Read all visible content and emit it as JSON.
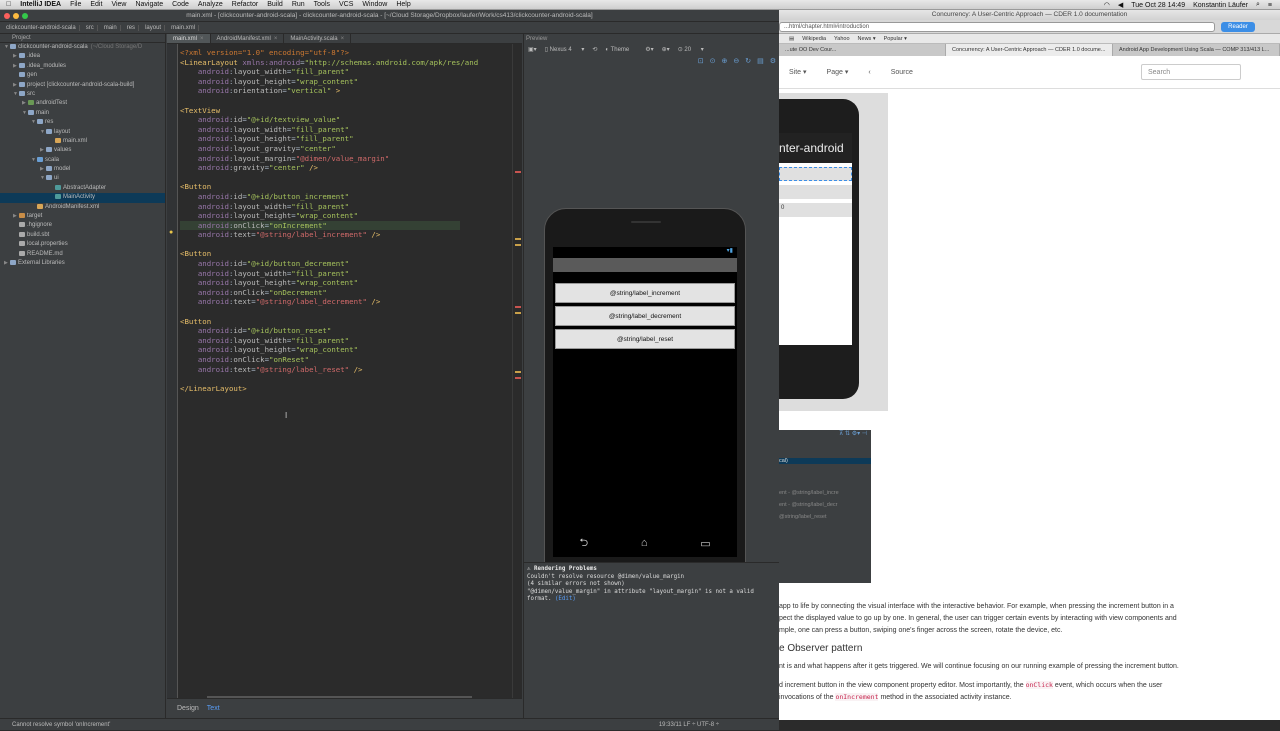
{
  "menubar": {
    "app": "IntelliJ IDEA",
    "items": [
      "File",
      "Edit",
      "View",
      "Navigate",
      "Code",
      "Analyze",
      "Refactor",
      "Build",
      "Run",
      "Tools",
      "VCS",
      "Window",
      "Help"
    ],
    "clock": "Tue Oct 28  14:49",
    "user": "Konstantin Läufer"
  },
  "ide": {
    "title": "main.xml - [clickcounter-android-scala] - clickcounter-android-scala - [~/Cloud Storage/Dropbox/laufer/Work/cs413/clickcounter-android-scala]",
    "breadcrumbs": [
      "clickcounter-android-scala",
      "src",
      "main",
      "res",
      "layout",
      "main.xml"
    ],
    "project_label": "Project",
    "tree": [
      {
        "label": "clickcounter-android-scala",
        "sub": "(~/Cloud Storage/D",
        "depth": 0,
        "arrow": "▼",
        "color": "#8ea7c7"
      },
      {
        "label": ".idea",
        "depth": 1,
        "arrow": "▶",
        "color": "#8ea7c7"
      },
      {
        "label": ".idea_modules",
        "depth": 1,
        "arrow": "▶",
        "color": "#8ea7c7"
      },
      {
        "label": "gen",
        "depth": 1,
        "arrow": "",
        "color": "#8ea7c7"
      },
      {
        "label": "project [clickcounter-android-scala-build]",
        "depth": 1,
        "arrow": "▶",
        "color": "#8ea7c7"
      },
      {
        "label": "src",
        "depth": 1,
        "arrow": "▼",
        "color": "#8ea7c7"
      },
      {
        "label": "androidTest",
        "depth": 2,
        "arrow": "▶",
        "color": "#6a9955"
      },
      {
        "label": "main",
        "depth": 2,
        "arrow": "▼",
        "color": "#8ea7c7"
      },
      {
        "label": "res",
        "depth": 3,
        "arrow": "▼",
        "color": "#8ea7c7"
      },
      {
        "label": "layout",
        "depth": 4,
        "arrow": "▼",
        "color": "#8ea7c7"
      },
      {
        "label": "main.xml",
        "depth": 5,
        "arrow": "",
        "color": "#d8a657"
      },
      {
        "label": "values",
        "depth": 4,
        "arrow": "▶",
        "color": "#8ea7c7"
      },
      {
        "label": "scala",
        "depth": 3,
        "arrow": "▼",
        "color": "#6a9fd4"
      },
      {
        "label": "model",
        "depth": 4,
        "arrow": "▶",
        "color": "#8ea7c7"
      },
      {
        "label": "ui",
        "depth": 4,
        "arrow": "▼",
        "color": "#8ea7c7"
      },
      {
        "label": "AbstractAdapter",
        "depth": 5,
        "arrow": "",
        "color": "#4e9a9a"
      },
      {
        "label": "MainActivity",
        "depth": 5,
        "arrow": "",
        "color": "#4e9a9a",
        "selected": true
      },
      {
        "label": "AndroidManifest.xml",
        "depth": 3,
        "arrow": "",
        "color": "#d8a657"
      },
      {
        "label": "target",
        "depth": 1,
        "arrow": "▶",
        "color": "#c98d47"
      },
      {
        "label": ".hgignore",
        "depth": 1,
        "arrow": "",
        "color": "#aaaaaa"
      },
      {
        "label": "build.sbt",
        "depth": 1,
        "arrow": "",
        "color": "#aaaaaa"
      },
      {
        "label": "local.properties",
        "depth": 1,
        "arrow": "",
        "color": "#aaaaaa"
      },
      {
        "label": "README.md",
        "depth": 1,
        "arrow": "",
        "color": "#aaaaaa"
      },
      {
        "label": "External Libraries",
        "depth": 0,
        "arrow": "▶",
        "color": "#8ea7c7"
      }
    ],
    "editor_tabs": [
      {
        "label": "main.xml",
        "active": true
      },
      {
        "label": "AndroidManifest.xml",
        "active": false
      },
      {
        "label": "MainActivity.scala",
        "active": false
      }
    ],
    "bottom_tabs": [
      "Design",
      "Text"
    ],
    "status_left": "Cannot resolve symbol 'onIncrement'",
    "status_right": "19:33/11    LF ÷    UTF-8 ÷"
  },
  "preview": {
    "header": "Preview",
    "device": "Nexus 4",
    "theme": "Theme",
    "api": "20",
    "buttons": [
      "@string/label_increment",
      "@string/label_decrement",
      "@string/label_reset"
    ],
    "problems_title": "Rendering Problems",
    "problems_lines": [
      "Couldn't resolve resource @dimen/value_margin",
      "(4 similar errors not shown)",
      "\"@dimen/value_margin\" in attribute \"layout_margin\" is not a valid",
      "format."
    ],
    "problems_link": "(Edit)"
  },
  "browser": {
    "window_title": "Concurrency: A User-Centric Approach — CDER 1.0 documentation",
    "url": "...html/chapter.html#introduction",
    "reader": "Reader",
    "bookmarks": [
      "Wikipedia",
      "Yahoo",
      "News ▾",
      "Popular ▾"
    ],
    "tabs": [
      "...ute OO Dev Cour...",
      "Concurrency: A User-Centric Approach — CDER 1.0 docume...",
      "Android App Development Using Scala — COMP 313/413 L..."
    ],
    "nav": [
      "Site ▾",
      "Page ▾",
      "‹",
      "Source"
    ],
    "search_placeholder": "Search",
    "screenshot_title": "nter-android",
    "screenshot2_rows": [
      "cal)",
      "ent - @string/label_incre",
      "ent - @string/label_decr",
      "@string/label_reset"
    ],
    "text_line1": "app to life by connecting the visual interface with the interactive behavior. For example, when pressing the increment button in a",
    "text_line2": "pect the displayed value to go up by one. In general, the user can trigger certain events by interacting with view components and",
    "text_line3": "mple, one can press a button, swiping one's finger across the screen, rotate the device, etc.",
    "heading": "e Observer pattern",
    "text_line4": "nt is and what happens after it gets triggered. We will continue focusing on our running example of pressing the increment button.",
    "text_line5a": "d increment button in the view component property editor. Most importantly, the",
    "code1": "onClick",
    "text_line5b": "event, which occurs when the user",
    "text_line6a": "invocations of the",
    "code2": "onIncrement",
    "text_line6b": "method in the associated activity instance."
  },
  "colors": {
    "ide_bg": "#2b2b2b",
    "panel": "#3c3f41",
    "accent": "#589df6",
    "tag": "#e8bf6a",
    "string": "#a5c25c"
  }
}
